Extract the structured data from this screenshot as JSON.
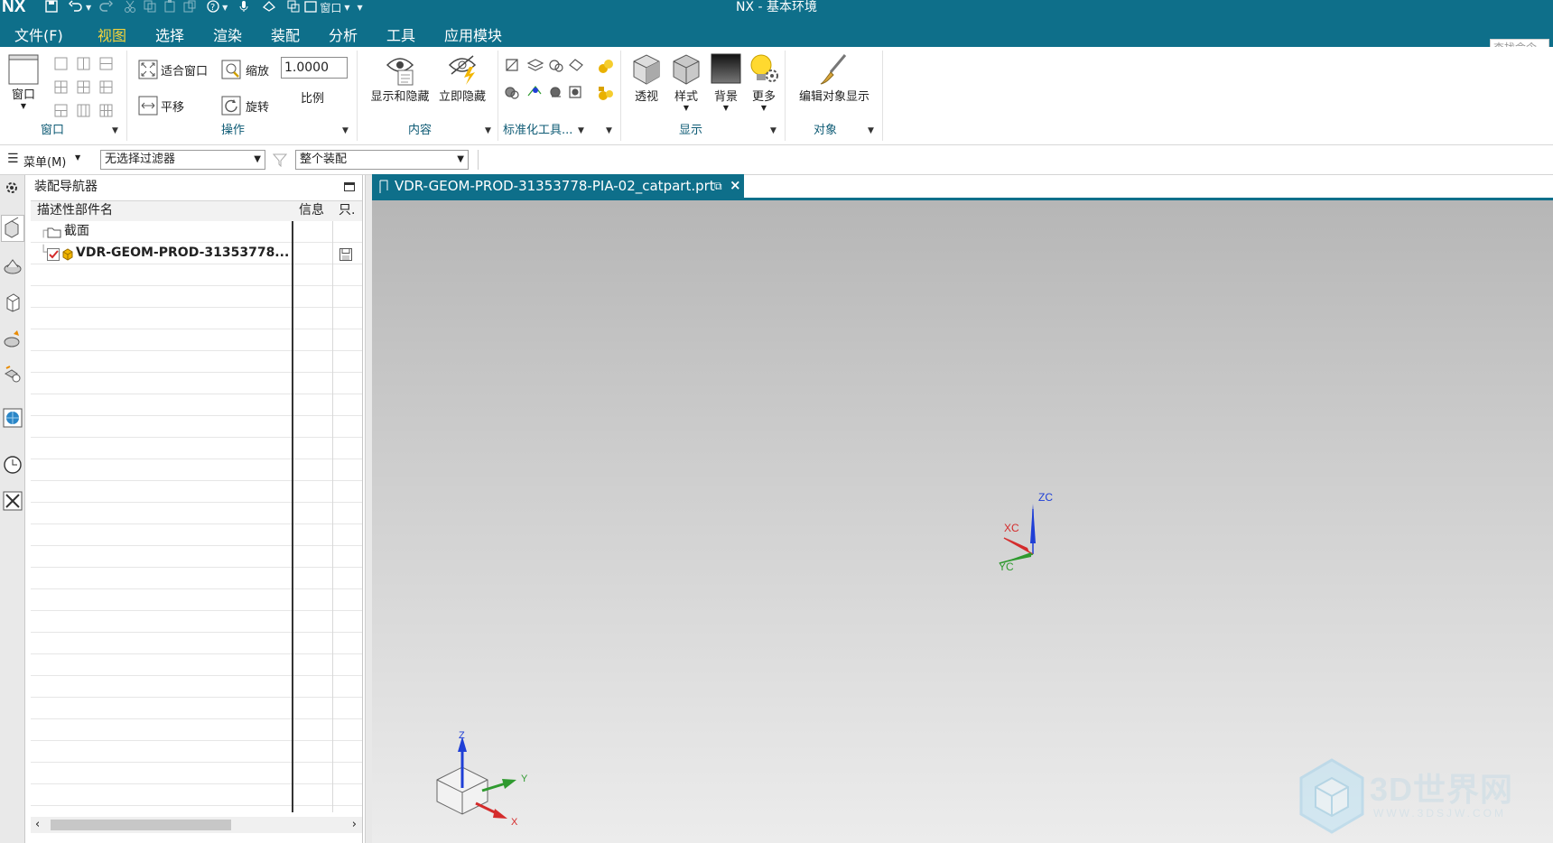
{
  "titlebar": {
    "logo": "NX",
    "window_menu": "窗口",
    "title": "NX - 基本环境"
  },
  "menu": {
    "tabs": [
      "文件(F)",
      "视图",
      "选择",
      "渲染",
      "装配",
      "分析",
      "工具",
      "应用模块"
    ],
    "active": "视图",
    "search_placeholder": "查找命令"
  },
  "ribbon": {
    "window_group": {
      "label": "窗口",
      "button": "窗口"
    },
    "operation_group": {
      "label": "操作",
      "fit": "适合窗口",
      "zoom": "缩放",
      "scale_value": "1.0000",
      "scale_label": "比例",
      "pan": "平移",
      "rotate": "旋转"
    },
    "content_group": {
      "label": "内容",
      "show_hide": "显示和隐藏",
      "immediate_hide": "立即隐藏"
    },
    "standard_group": {
      "label": "标准化工具..."
    },
    "display_group": {
      "label": "显示",
      "perspective": "透视",
      "style": "样式",
      "background": "背景",
      "more": "更多"
    },
    "object_group": {
      "label": "对象",
      "edit_display": "编辑对象显示"
    }
  },
  "selbar": {
    "menu": "菜单(M)",
    "filter": "无选择过滤器",
    "scope": "整个装配"
  },
  "navigator": {
    "title": "装配导航器",
    "columns": [
      "描述性部件名",
      "信息",
      "只."
    ],
    "rows": [
      {
        "name": "截面",
        "type": "folder"
      },
      {
        "name": "VDR-GEOM-PROD-31353778...",
        "type": "part",
        "checked": true
      }
    ]
  },
  "document": {
    "tab_label": "VDR-GEOM-PROD-31353778-PIA-02_catpart.prt"
  },
  "viewport": {
    "wcs": {
      "z": "ZC",
      "x": "XC",
      "y": "YC"
    },
    "triad": {
      "z": "Z",
      "x": "X",
      "y": "Y"
    },
    "watermark": {
      "brand": "3D世界网",
      "url": "WWW.3DSJW.COM"
    },
    "colors": {
      "x": "#d42b2b",
      "y": "#2f9a2f",
      "z": "#1f3fd6"
    }
  }
}
